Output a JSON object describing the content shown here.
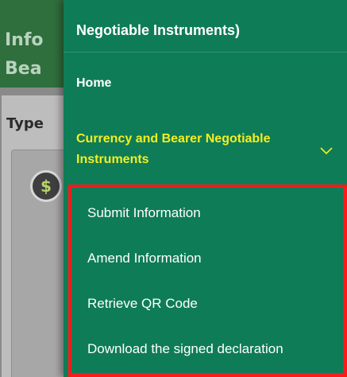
{
  "background": {
    "header_lines": [
      "Info",
      "Bea"
    ],
    "type_label": "Type",
    "icon": "money-bag-icon"
  },
  "drawer": {
    "title": "Negotiable Instruments)",
    "home_label": "Home",
    "section_label": "Currency and Bearer Negotiable Instruments",
    "section_icon": "chevron-down-icon",
    "submenu": [
      {
        "label": "Submit Information"
      },
      {
        "label": "Amend Information"
      },
      {
        "label": "Retrieve QR Code"
      },
      {
        "label": "Download the signed declaration"
      }
    ]
  },
  "colors": {
    "drawer_bg": "#0e7c57",
    "active_section": "#f5ee1f",
    "highlight_border": "#ff1a1a",
    "header_bg": "#2f6e3d"
  }
}
